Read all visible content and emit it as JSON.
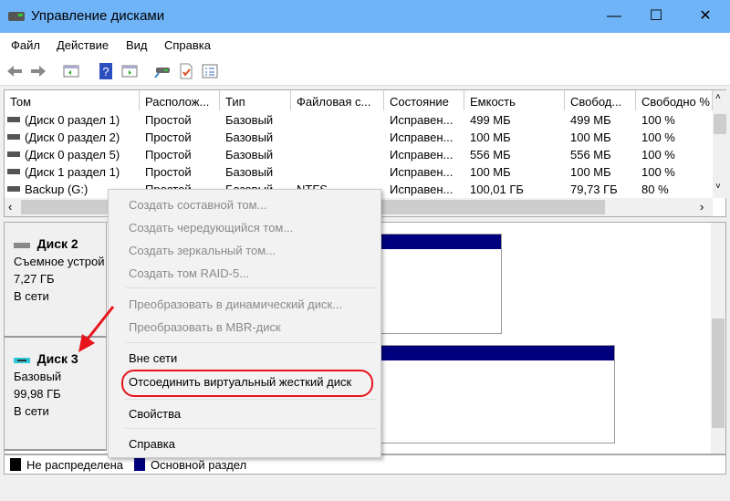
{
  "window": {
    "title": "Управление дисками",
    "minimize": "—",
    "maximize": "☐",
    "close": "✕"
  },
  "menu": [
    "Файл",
    "Действие",
    "Вид",
    "Справка"
  ],
  "toolbar": [
    "back-icon",
    "forward-icon",
    "console-tree-icon",
    "help-icon",
    "action-pane-icon",
    "connect-disk-icon",
    "checklist-icon",
    "properties-list-icon"
  ],
  "table": {
    "columns": [
      "Том",
      "Располож...",
      "Тип",
      "Файловая с...",
      "Состояние",
      "Емкость",
      "Свобод...",
      "Свободно %"
    ],
    "rows": [
      [
        "(Диск 0 раздел 1)",
        "Простой",
        "Базовый",
        "",
        "Исправен...",
        "499 МБ",
        "499 МБ",
        "100 %"
      ],
      [
        "(Диск 0 раздел 2)",
        "Простой",
        "Базовый",
        "",
        "Исправен...",
        "100 МБ",
        "100 МБ",
        "100 %"
      ],
      [
        "(Диск 0 раздел 5)",
        "Простой",
        "Базовый",
        "",
        "Исправен...",
        "556 МБ",
        "556 МБ",
        "100 %"
      ],
      [
        "(Диск 1 раздел 1)",
        "Простой",
        "Базовый",
        "",
        "Исправен...",
        "100 МБ",
        "100 МБ",
        "100 %"
      ],
      [
        "Backup (G:)",
        "Простой",
        "Базовый",
        "NTFS",
        "Исправен...",
        "100,01 ГБ",
        "79,73 ГБ",
        "80 %"
      ]
    ]
  },
  "disks": [
    {
      "name": "Диск 2",
      "type": "Съемное устрой",
      "size": "7,27 ГБ",
      "status": "В сети"
    },
    {
      "name": "Диск 3",
      "type": "Базовый",
      "size": "99,98 ГБ",
      "status": "В сети"
    }
  ],
  "legend": [
    {
      "label": "Не распределена",
      "color": "#000000"
    },
    {
      "label": "Основной раздел",
      "color": "#00007f"
    }
  ],
  "context_menu": {
    "items": [
      {
        "label": "Создать составной том...",
        "enabled": false
      },
      {
        "label": "Создать чередующийся том...",
        "enabled": false
      },
      {
        "label": "Создать зеркальный том...",
        "enabled": false
      },
      {
        "label": "Создать том RAID-5...",
        "enabled": false
      },
      {
        "label": "Преобразовать в динамический диск...",
        "enabled": false
      },
      {
        "label": "Преобразовать в MBR-диск",
        "enabled": false
      },
      {
        "label": "Вне сети",
        "enabled": true
      },
      {
        "label": "Отсоединить виртуальный жесткий диск",
        "enabled": true,
        "highlighted": true
      },
      {
        "label": "Свойства",
        "enabled": true
      },
      {
        "label": "Справка",
        "enabled": true
      }
    ]
  },
  "colors": {
    "titlebar": "#70b4f8",
    "primary_partition": "#00007f",
    "annotation": "#e8141c"
  }
}
